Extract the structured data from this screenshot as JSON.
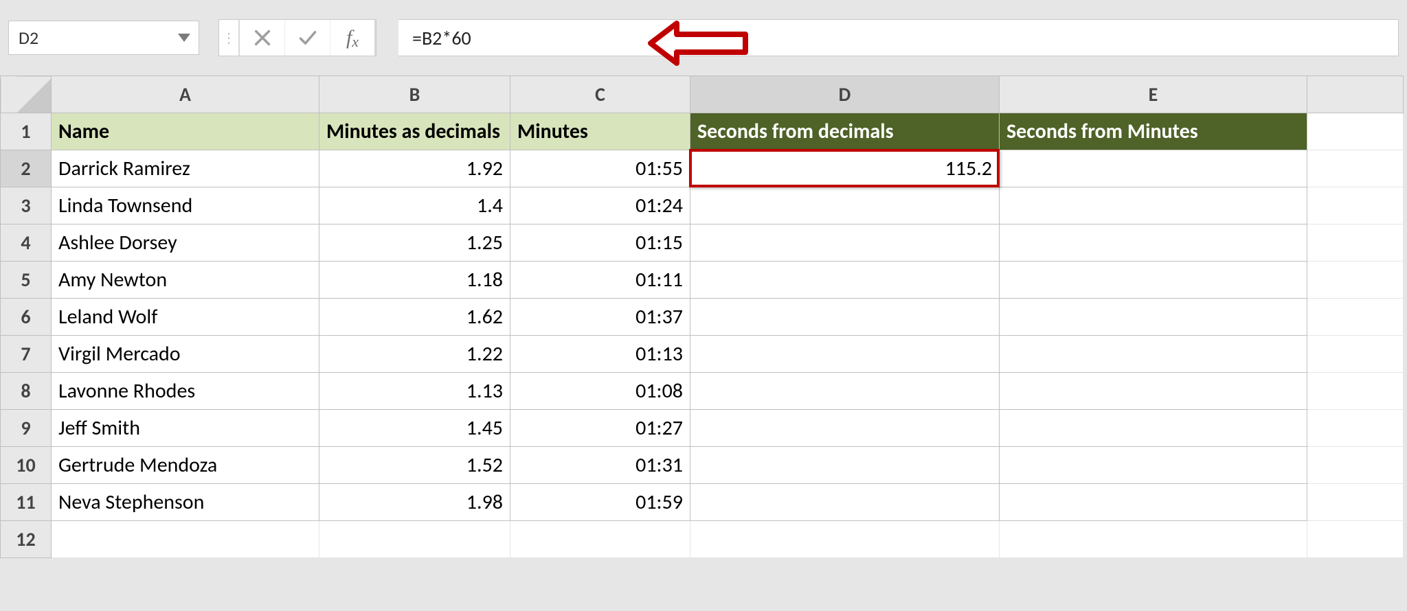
{
  "name_box": {
    "value": "D2"
  },
  "formula_bar": {
    "value": "=B2*60"
  },
  "columns": {
    "A": "A",
    "B": "B",
    "C": "C",
    "D": "D",
    "E": "E"
  },
  "row_numbers": [
    "1",
    "2",
    "3",
    "4",
    "5",
    "6",
    "7",
    "8",
    "9",
    "10",
    "11",
    "12"
  ],
  "headers": {
    "A": "Name",
    "B": "Minutes as decimals",
    "C": "Minutes",
    "D": "Seconds from decimals",
    "E": "Seconds from Minutes"
  },
  "rows": [
    {
      "name": "Darrick Ramirez",
      "dec": "1.92",
      "min": "01:55",
      "sec_dec": "115.2",
      "sec_min": ""
    },
    {
      "name": "Linda Townsend",
      "dec": "1.4",
      "min": "01:24",
      "sec_dec": "",
      "sec_min": ""
    },
    {
      "name": "Ashlee Dorsey",
      "dec": "1.25",
      "min": "01:15",
      "sec_dec": "",
      "sec_min": ""
    },
    {
      "name": "Amy Newton",
      "dec": "1.18",
      "min": "01:11",
      "sec_dec": "",
      "sec_min": ""
    },
    {
      "name": "Leland Wolf",
      "dec": "1.62",
      "min": "01:37",
      "sec_dec": "",
      "sec_min": ""
    },
    {
      "name": "Virgil Mercado",
      "dec": "1.22",
      "min": "01:13",
      "sec_dec": "",
      "sec_min": ""
    },
    {
      "name": "Lavonne Rhodes",
      "dec": "1.13",
      "min": "01:08",
      "sec_dec": "",
      "sec_min": ""
    },
    {
      "name": "Jeff Smith",
      "dec": "1.45",
      "min": "01:27",
      "sec_dec": "",
      "sec_min": ""
    },
    {
      "name": "Gertrude Mendoza",
      "dec": "1.52",
      "min": "01:31",
      "sec_dec": "",
      "sec_min": ""
    },
    {
      "name": "Neva Stephenson",
      "dec": "1.98",
      "min": "01:59",
      "sec_dec": "",
      "sec_min": ""
    }
  ],
  "chart_data": {
    "type": "table",
    "title": "Minutes to Seconds worksheet",
    "columns": [
      "Name",
      "Minutes as decimals",
      "Minutes",
      "Seconds from decimals",
      "Seconds from Minutes"
    ],
    "data": [
      [
        "Darrick Ramirez",
        1.92,
        "01:55",
        115.2,
        null
      ],
      [
        "Linda Townsend",
        1.4,
        "01:24",
        null,
        null
      ],
      [
        "Ashlee Dorsey",
        1.25,
        "01:15",
        null,
        null
      ],
      [
        "Amy Newton",
        1.18,
        "01:11",
        null,
        null
      ],
      [
        "Leland Wolf",
        1.62,
        "01:37",
        null,
        null
      ],
      [
        "Virgil Mercado",
        1.22,
        "01:13",
        null,
        null
      ],
      [
        "Lavonne Rhodes",
        1.13,
        "01:08",
        null,
        null
      ],
      [
        "Jeff Smith",
        1.45,
        "01:27",
        null,
        null
      ],
      [
        "Gertrude Mendoza",
        1.52,
        "01:31",
        null,
        null
      ],
      [
        "Neva Stephenson",
        1.98,
        "01:59",
        null,
        null
      ]
    ],
    "formula_D2": "=B2*60"
  }
}
